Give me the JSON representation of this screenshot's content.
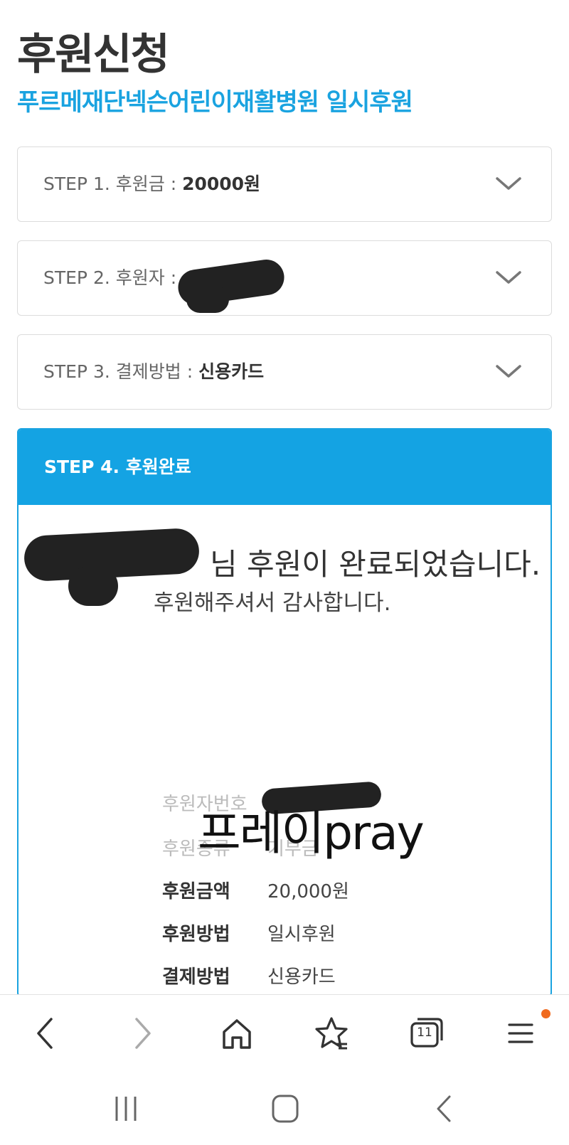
{
  "header": {
    "title": "후원신청",
    "subtitle": "푸르메재단넥슨어린이재활병원 일시후원"
  },
  "steps": [
    {
      "label": "STEP 1. 후원금 : ",
      "value": "20000원"
    },
    {
      "label": "STEP 2. 후원자 : ",
      "value": ""
    },
    {
      "label": "STEP 3. 결제방법 : ",
      "value": "신용카드"
    }
  ],
  "step4": {
    "title": "STEP 4. 후원완료",
    "complete_message": "님 후원이 완료되었습니다.",
    "thanks_message": "후원해주셔서 감사합니다.",
    "overlay_text": "프레이pray",
    "details": [
      {
        "key": "후원자번호",
        "value": ""
      },
      {
        "key": "후원종류",
        "value": "기부금"
      },
      {
        "key": "후원금액",
        "value": "20,000원"
      },
      {
        "key": "후원방법",
        "value": "일시후원"
      },
      {
        "key": "결제방법",
        "value": "신용카드"
      }
    ]
  },
  "browser_nav": {
    "tab_count": "11"
  },
  "colors": {
    "accent": "#14a3e3",
    "subtitle": "#1aa3e0",
    "notification": "#f06a1e"
  },
  "icons": [
    "chevron-down-icon",
    "back-icon",
    "forward-icon",
    "home-icon",
    "bookmark-star-icon",
    "tabs-icon",
    "menu-icon",
    "recent-apps-icon",
    "home-button-icon",
    "system-back-icon"
  ]
}
